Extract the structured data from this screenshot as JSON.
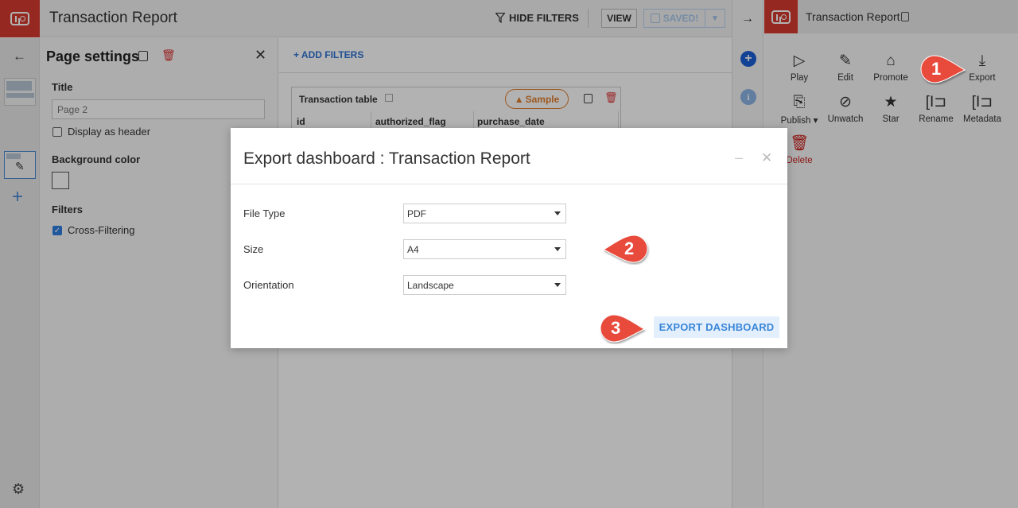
{
  "app": {
    "title": "Transaction Report",
    "hide_filters_label": "HIDE FILTERS",
    "view_label": "VIEW",
    "saved_label": "SAVED!"
  },
  "page_settings": {
    "title": "Page settings",
    "title_label": "Title",
    "title_placeholder": "Page 2",
    "display_as_header_label": "Display as header",
    "display_as_header_checked": false,
    "background_color_label": "Background color",
    "filters_label": "Filters",
    "cross_filtering_label": "Cross-Filtering",
    "cross_filtering_checked": true
  },
  "canvas": {
    "add_filters_label": "ADD FILTERS",
    "tile": {
      "title": "Transaction table",
      "badge": "Sample",
      "columns": [
        "id",
        "authorized_flag",
        "purchase_date"
      ]
    }
  },
  "right_panel": {
    "title": "Transaction Report",
    "actions": [
      {
        "label": "Play",
        "icon": "play-icon"
      },
      {
        "label": "Edit",
        "icon": "pencil-icon"
      },
      {
        "label": "Promote",
        "icon": "bookmark-icon"
      },
      {
        "label": "Export",
        "icon": "download-icon"
      },
      {
        "label": "Publish",
        "icon": "publish-icon"
      },
      {
        "label": "Unwatch",
        "icon": "eye-off-icon"
      },
      {
        "label": "Star",
        "icon": "star-icon"
      },
      {
        "label": "Rename",
        "icon": "rename-icon"
      },
      {
        "label": "Metadata",
        "icon": "metadata-icon"
      },
      {
        "label": "Delete",
        "icon": "trash-icon"
      }
    ]
  },
  "modal": {
    "title": "Export dashboard : Transaction Report",
    "fields": [
      {
        "label": "File Type",
        "value": "PDF"
      },
      {
        "label": "Size",
        "value": "A4"
      },
      {
        "label": "Orientation",
        "value": "Landscape"
      }
    ],
    "export_label": "EXPORT DASHBOARD"
  },
  "callouts": [
    "1",
    "2",
    "3"
  ],
  "colors": {
    "brand": "#d63b30",
    "accent": "#2f72d4",
    "callout": "#e84a3c",
    "sample_badge": "#e08030",
    "danger": "#c8201c"
  }
}
